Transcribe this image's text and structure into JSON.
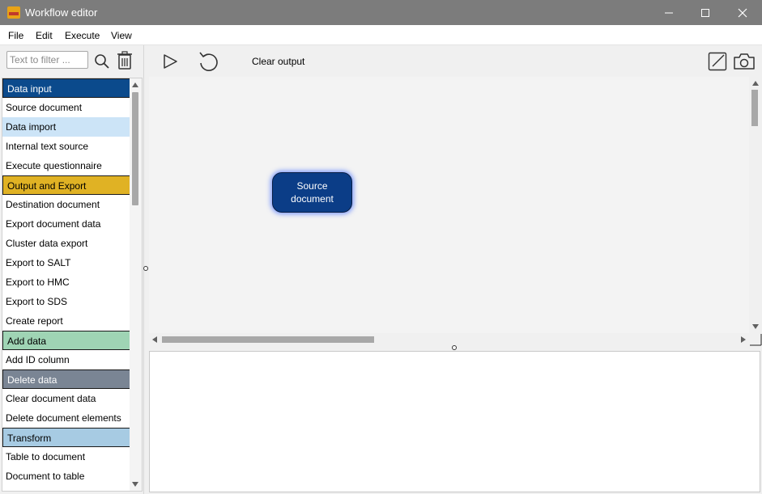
{
  "window": {
    "title": "Workflow editor"
  },
  "menu": {
    "items": [
      "File",
      "Edit",
      "Execute",
      "View"
    ]
  },
  "left_panel": {
    "filter_placeholder": "Text to filter ...",
    "items": [
      {
        "label": "Data input",
        "kind": "header",
        "bg": "#0b4a8c",
        "fg": "#ffffff"
      },
      {
        "label": "Source document",
        "kind": "item"
      },
      {
        "label": "Data import",
        "kind": "item",
        "selected": true
      },
      {
        "label": "Internal text source",
        "kind": "item"
      },
      {
        "label": "Execute questionnaire",
        "kind": "item"
      },
      {
        "label": "Output and Export",
        "kind": "header",
        "bg": "#e0b224",
        "fg": "#000000"
      },
      {
        "label": "Destination document",
        "kind": "item"
      },
      {
        "label": "Export document data",
        "kind": "item"
      },
      {
        "label": "Cluster data export",
        "kind": "item"
      },
      {
        "label": "Export to SALT",
        "kind": "item"
      },
      {
        "label": "Export to HMC",
        "kind": "item"
      },
      {
        "label": "Export to SDS",
        "kind": "item"
      },
      {
        "label": "Create report",
        "kind": "item"
      },
      {
        "label": "Add data",
        "kind": "header",
        "bg": "#9fd4b4",
        "fg": "#000000"
      },
      {
        "label": "Add ID column",
        "kind": "item"
      },
      {
        "label": "Delete data",
        "kind": "header",
        "bg": "#7a8594",
        "fg": "#ffffff"
      },
      {
        "label": "Clear document data",
        "kind": "item"
      },
      {
        "label": "Delete document elements",
        "kind": "item"
      },
      {
        "label": "Transform",
        "kind": "header",
        "bg": "#a7cbe3",
        "fg": "#000000"
      },
      {
        "label": "Table to document",
        "kind": "item"
      },
      {
        "label": "Document to table",
        "kind": "item"
      }
    ]
  },
  "toolbar": {
    "clear_output_label": "Clear output"
  },
  "canvas": {
    "node_label_line1": "Source",
    "node_label_line2": "document"
  },
  "colors": {
    "titlebar": "#7c7c7c",
    "node_fill": "#0b3d87",
    "selected_item": "#cce4f7"
  }
}
